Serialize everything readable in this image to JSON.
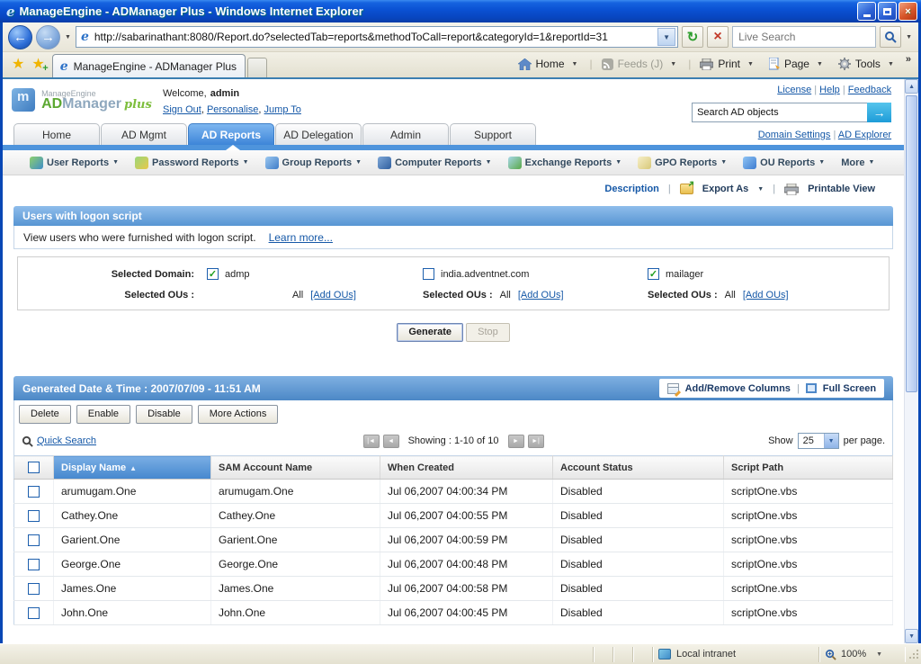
{
  "window": {
    "title": "ManageEngine - ADManager Plus - Windows Internet Explorer",
    "url": "http://sabarinathant:8080/Report.do?selectedTab=reports&methodToCall=report&categoryId=1&reportId=31",
    "live_search_placeholder": "Live Search",
    "tab_title": "ManageEngine - ADManager Plus",
    "toolbar": {
      "home": "Home",
      "feeds": "Feeds (J)",
      "print": "Print",
      "page": "Page",
      "tools": "Tools",
      "overflow": "»"
    },
    "status": {
      "zone": "Local intranet",
      "zoom": "100%"
    }
  },
  "app": {
    "logo": {
      "brand": "ManageEngine",
      "ad": "AD",
      "manager": "Manager",
      "plus": "plus"
    },
    "welcome_label": "Welcome,",
    "username": "admin",
    "session_links": [
      "Sign Out",
      "Personalise",
      "Jump To"
    ],
    "top_links": [
      "License",
      "Help",
      "Feedback"
    ],
    "search_value": "Search AD objects",
    "nav_tabs": [
      "Home",
      "AD Mgmt",
      "AD Reports",
      "AD Delegation",
      "Admin",
      "Support"
    ],
    "active_tab": "AD Reports",
    "right_links": [
      "Domain Settings",
      "AD Explorer"
    ],
    "menu": [
      "User Reports",
      "Password Reports",
      "Group Reports",
      "Computer Reports",
      "Exchange Reports",
      "GPO Reports",
      "OU Reports",
      "More"
    ],
    "actions": {
      "description": "Description",
      "export_as": "Export As",
      "printable_view": "Printable View"
    }
  },
  "report": {
    "title": "Users with logon script",
    "description": "View users who were furnished with logon script.",
    "learn_more": "Learn more...",
    "selected_domain_label": "Selected Domain:",
    "domains": [
      {
        "name": "admp",
        "checked": true,
        "ou_label": "Selected OUs :",
        "ou_value": "All",
        "add_ous": "[Add OUs]"
      },
      {
        "name": "india.adventnet.com",
        "checked": false,
        "ou_label": "Selected OUs :",
        "ou_value": "All",
        "add_ous": "[Add OUs]"
      },
      {
        "name": "mailager",
        "checked": true,
        "ou_label": "Selected OUs :",
        "ou_value": "All",
        "add_ous": "[Add OUs]"
      }
    ],
    "generate_label": "Generate",
    "stop_label": "Stop",
    "generated_bar": {
      "text": "Generated Date & Time : 2007/07/09 - 11:51 AM",
      "add_remove_columns": "Add/Remove Columns",
      "full_screen": "Full Screen"
    },
    "row_actions": [
      "Delete",
      "Enable",
      "Disable",
      "More Actions"
    ],
    "quick_search": "Quick Search",
    "paging": {
      "showing": "Showing : 1-10 of 10",
      "show_label": "Show",
      "page_size": "25",
      "per_page": "per page."
    },
    "table": {
      "columns": [
        "Display Name",
        "SAM Account Name",
        "When Created",
        "Account Status",
        "Script Path"
      ],
      "sorted_column": "Display Name",
      "rows": [
        [
          "arumugam.One",
          "arumugam.One",
          "Jul 06,2007 04:00:34 PM",
          "Disabled",
          "scriptOne.vbs"
        ],
        [
          "Cathey.One",
          "Cathey.One",
          "Jul 06,2007 04:00:55 PM",
          "Disabled",
          "scriptOne.vbs"
        ],
        [
          "Garient.One",
          "Garient.One",
          "Jul 06,2007 04:00:59 PM",
          "Disabled",
          "scriptOne.vbs"
        ],
        [
          "George.One",
          "George.One",
          "Jul 06,2007 04:00:48 PM",
          "Disabled",
          "scriptOne.vbs"
        ],
        [
          "James.One",
          "James.One",
          "Jul 06,2007 04:00:58 PM",
          "Disabled",
          "scriptOne.vbs"
        ],
        [
          "John.One",
          "John.One",
          "Jul 06,2007 04:00:45 PM",
          "Disabled",
          "scriptOne.vbs"
        ]
      ]
    }
  },
  "colors": {
    "titlebar_blue": "#0A50D2",
    "link_blue": "#1558A7",
    "active_tab_blue": "#3D85D8",
    "panel_header_blue": "#5795D3",
    "sorted_header_blue": "#4587CE",
    "check_green": "#1F9E1F",
    "search_go_cyan": "#1E9CD8",
    "close_btn_orange": "#D8572A"
  }
}
